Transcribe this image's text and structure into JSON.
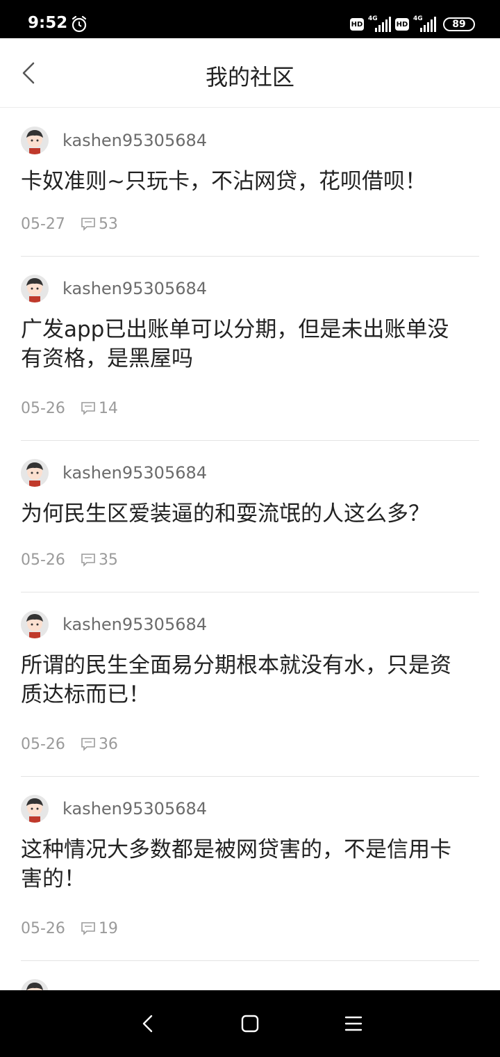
{
  "status_bar": {
    "time": "9:52",
    "battery": "89",
    "network_1": "4G",
    "network_2": "4G",
    "hd_label": "HD"
  },
  "header": {
    "title": "我的社区"
  },
  "posts": [
    {
      "username": "kashen95305684",
      "text": "卡奴准则~只玩卡，不沾网贷，花呗借呗！",
      "date": "05-27",
      "comments": "53"
    },
    {
      "username": "kashen95305684",
      "text": "广发app已出账单可以分期，但是未出账单没有资格，是黑屋吗",
      "date": "05-26",
      "comments": "14"
    },
    {
      "username": "kashen95305684",
      "text": "为何民生区爱装逼的和耍流氓的人这么多？",
      "date": "05-26",
      "comments": "35"
    },
    {
      "username": "kashen95305684",
      "text": "所谓的民生全面易分期根本就没有水，只是资质达标而已！",
      "date": "05-26",
      "comments": "36"
    },
    {
      "username": "kashen95305684",
      "text": "这种情况大多数都是被网贷害的，不是信用卡害的！",
      "date": "05-26",
      "comments": "19"
    }
  ],
  "icons": {
    "back": "chevron-left-icon",
    "comment": "comment-icon",
    "alarm": "alarm-clock-icon"
  }
}
